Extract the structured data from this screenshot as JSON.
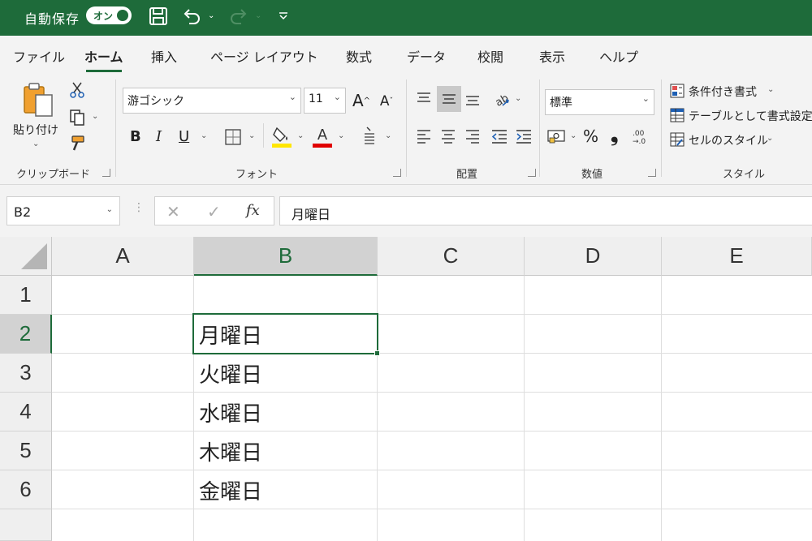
{
  "titlebar": {
    "autosave_label": "自動保存",
    "toggle_label": "オン"
  },
  "tabs": [
    {
      "label": "ファイル",
      "active": false
    },
    {
      "label": "ホーム",
      "active": true
    },
    {
      "label": "挿入",
      "active": false
    },
    {
      "label": "ページ レイアウト",
      "active": false
    },
    {
      "label": "数式",
      "active": false
    },
    {
      "label": "データ",
      "active": false
    },
    {
      "label": "校閲",
      "active": false
    },
    {
      "label": "表示",
      "active": false
    },
    {
      "label": "ヘルプ",
      "active": false
    }
  ],
  "ribbon": {
    "clipboard": {
      "paste_label": "貼り付け",
      "group_label": "クリップボード"
    },
    "font": {
      "font_name": "游ゴシック",
      "font_size": "11",
      "group_label": "フォント",
      "bold": "B",
      "italic": "I",
      "underline": "U"
    },
    "alignment": {
      "group_label": "配置"
    },
    "number": {
      "format": "標準",
      "percent": "%",
      "comma": "❟",
      "group_label": "数値"
    },
    "styles": {
      "conditional": "条件付き書式",
      "table": "テーブルとして書式設定",
      "cell_styles": "セルのスタイル",
      "group_label": "スタイル"
    }
  },
  "formula_bar": {
    "name_box": "B2",
    "fx": "fx",
    "value": "月曜日"
  },
  "grid": {
    "columns": [
      "A",
      "B",
      "C",
      "D",
      "E"
    ],
    "selected_column": "B",
    "rows": [
      "1",
      "2",
      "3",
      "4",
      "5",
      "6"
    ],
    "selected_row": "2",
    "cells": {
      "B2": "月曜日",
      "B3": "火曜日",
      "B4": "水曜日",
      "B5": "木曜日",
      "B6": "金曜日"
    }
  },
  "colors": {
    "accent": "#1e6b3a",
    "fill_bar": "#ffe600",
    "font_bar": "#e00000"
  }
}
